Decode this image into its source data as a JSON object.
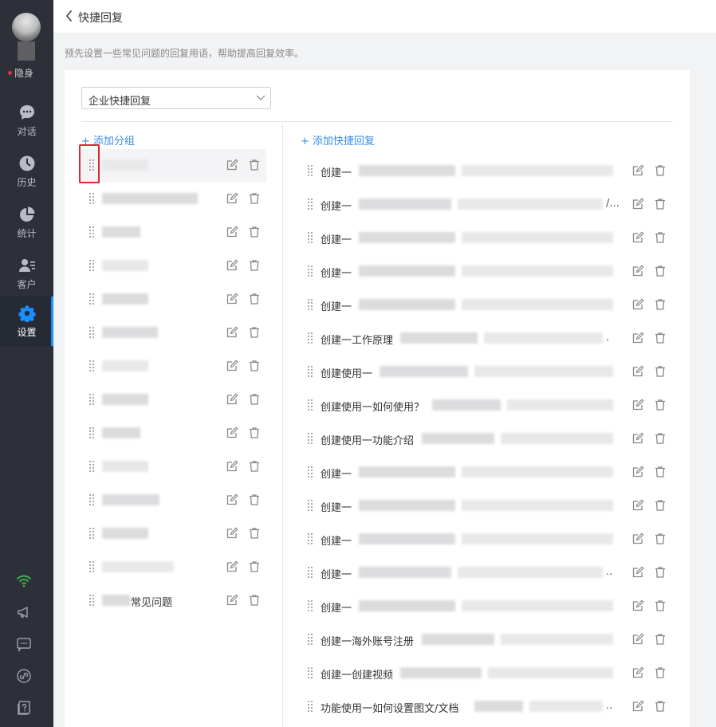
{
  "sidebar": {
    "status_label": "隐身",
    "nav": [
      {
        "label": "对话",
        "icon": "chat-icon"
      },
      {
        "label": "历史",
        "icon": "clock-icon"
      },
      {
        "label": "统计",
        "icon": "pie-chart-icon"
      },
      {
        "label": "客户",
        "icon": "customer-icon"
      },
      {
        "label": "设置",
        "icon": "gear-icon",
        "active": true
      }
    ],
    "bottom_icons": [
      "wifi-icon",
      "megaphone-icon",
      "message-icon",
      "link-icon",
      "help-icon"
    ],
    "accent_color": "#1890ff"
  },
  "header": {
    "title": "快捷回复",
    "description": "预先设置一些常见问题的回复用语，帮助提高回复效率。"
  },
  "scope_select": {
    "value": "企业快捷回复"
  },
  "groups": {
    "add_label": "添加分组",
    "items": [
      {
        "label": "",
        "selected": true
      },
      {
        "label": ""
      },
      {
        "label": ""
      },
      {
        "label": ""
      },
      {
        "label": ""
      },
      {
        "label": ""
      },
      {
        "label": ""
      },
      {
        "label": ""
      },
      {
        "label": ""
      },
      {
        "label": ""
      },
      {
        "label": ""
      },
      {
        "label": ""
      },
      {
        "label": ""
      },
      {
        "label": "常见问题"
      }
    ]
  },
  "replies": {
    "add_label": "添加快捷回复",
    "items": [
      {
        "label": "创建一",
        "trail": ""
      },
      {
        "label": "创建一",
        "trail": "/..."
      },
      {
        "label": "创建一",
        "trail": ""
      },
      {
        "label": "创建一",
        "trail": ""
      },
      {
        "label": "创建一",
        "trail": ""
      },
      {
        "label": "创建一工作原理",
        "trail": "."
      },
      {
        "label": "创建使用一",
        "trail": ""
      },
      {
        "label": "创建使用一如何使用？",
        "trail": ""
      },
      {
        "label": "创建使用一功能介绍",
        "trail": ""
      },
      {
        "label": "创建一",
        "trail": ""
      },
      {
        "label": "创建一",
        "trail": ""
      },
      {
        "label": "创建一",
        "trail": ""
      },
      {
        "label": "创建一",
        "trail": ".."
      },
      {
        "label": "创建一",
        "trail": ""
      },
      {
        "label": "创建一海外账号注册",
        "trail": ""
      },
      {
        "label": "创建一创建视频",
        "trail": ""
      },
      {
        "label": "功能使用一如何设置图文/文档",
        "trail": ".."
      }
    ]
  }
}
